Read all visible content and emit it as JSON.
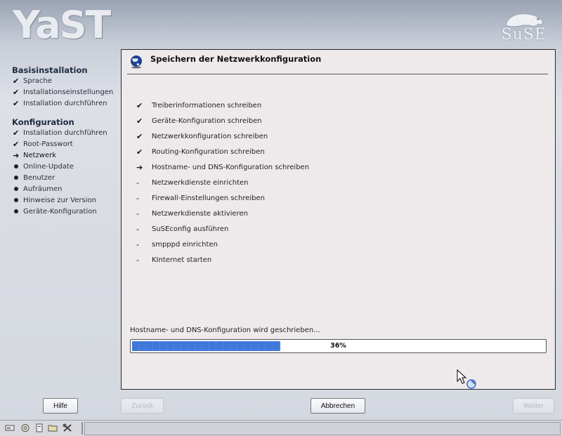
{
  "header": {
    "app_logo": "YaST",
    "brand_logo": "SuSE"
  },
  "sidebar": {
    "sections": [
      {
        "title": "Basisinstallation",
        "items": [
          {
            "label": "Sprache",
            "state": "done"
          },
          {
            "label": "Installationseinstellungen",
            "state": "done"
          },
          {
            "label": "Installation durchführen",
            "state": "done"
          }
        ]
      },
      {
        "title": "Konfiguration",
        "items": [
          {
            "label": "Installation durchführen",
            "state": "done"
          },
          {
            "label": "Root-Passwort",
            "state": "done"
          },
          {
            "label": "Netzwerk",
            "state": "current"
          },
          {
            "label": "Online-Update",
            "state": "pending"
          },
          {
            "label": "Benutzer",
            "state": "pending"
          },
          {
            "label": "Aufräumen",
            "state": "pending"
          },
          {
            "label": "Hinweise zur Version",
            "state": "pending"
          },
          {
            "label": "Geräte-Konfiguration",
            "state": "pending"
          }
        ]
      }
    ]
  },
  "main": {
    "title": "Speichern der Netzwerkkonfiguration",
    "icon": "network-globe-icon",
    "tasks": [
      {
        "label": "Treiberinformationen schreiben",
        "state": "done"
      },
      {
        "label": "Geräte-Konfiguration schreiben",
        "state": "done"
      },
      {
        "label": "Netzwerkkonfiguration schreiben",
        "state": "done"
      },
      {
        "label": "Routing-Konfiguration schreiben",
        "state": "done"
      },
      {
        "label": "Hostname- und DNS-Konfiguration schreiben",
        "state": "current"
      },
      {
        "label": "Netzwerkdienste einrichten",
        "state": "pending"
      },
      {
        "label": "Firewall-Einstellungen schreiben",
        "state": "pending"
      },
      {
        "label": "Netzwerkdienste aktivieren",
        "state": "pending"
      },
      {
        "label": "SuSEconfig ausführen",
        "state": "pending"
      },
      {
        "label": "smpppd einrichten",
        "state": "pending"
      },
      {
        "label": "KInternet starten",
        "state": "pending"
      }
    ],
    "status_text": "Hostname- und DNS-Konfiguration wird geschrieben...",
    "progress": {
      "fraction": 0.36,
      "label": "36%"
    }
  },
  "buttons": {
    "help": "Hilfe",
    "back": "Zurück",
    "abort": "Abbrechen",
    "next": "Weiter"
  },
  "colors": {
    "progress_fill": "#3f78d9",
    "panel_bg": "#eeeaeb"
  }
}
